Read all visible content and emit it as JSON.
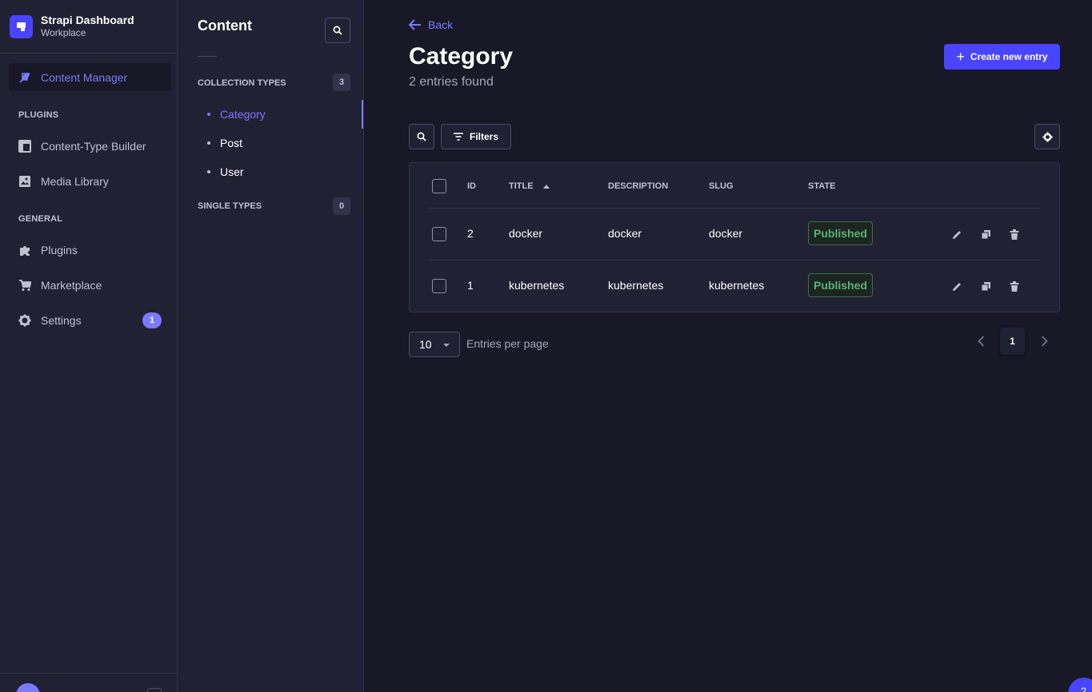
{
  "brand": {
    "title": "Strapi Dashboard",
    "subtitle": "Workplace",
    "accent": "#4945ff"
  },
  "sidebar": {
    "active_item": {
      "label": "Content Manager",
      "icon": "feather-icon"
    },
    "plugins_heading": "PLUGINS",
    "plugin_items": [
      {
        "label": "Content-Type Builder",
        "icon": "layout-icon"
      },
      {
        "label": "Media Library",
        "icon": "image-icon"
      }
    ],
    "general_heading": "GENERAL",
    "general_items": [
      {
        "label": "Plugins",
        "icon": "puzzle-icon"
      },
      {
        "label": "Marketplace",
        "icon": "cart-icon"
      },
      {
        "label": "Settings",
        "icon": "gear-icon",
        "badge": "1"
      }
    ]
  },
  "subnav": {
    "title": "Content",
    "collection_heading": "COLLECTION TYPES",
    "collection_count": "3",
    "collection_items": [
      "Category",
      "Post",
      "User"
    ],
    "active_item": "Category",
    "single_heading": "SINGLE TYPES",
    "single_count": "0"
  },
  "header": {
    "back_label": "Back",
    "title": "Category",
    "subtitle": "2 entries found",
    "create_label": "Create new entry"
  },
  "toolbar": {
    "filters_label": "Filters"
  },
  "table": {
    "columns": [
      "ID",
      "TITLE",
      "DESCRIPTION",
      "SLUG",
      "STATE"
    ],
    "sort_column": "TITLE",
    "rows": [
      {
        "id": "2",
        "title": "docker",
        "description": "docker",
        "slug": "docker",
        "state": "Published"
      },
      {
        "id": "1",
        "title": "kubernetes",
        "description": "kubernetes",
        "slug": "kubernetes",
        "state": "Published"
      }
    ]
  },
  "pagination": {
    "per_page_value": "10",
    "per_page_label": "Entries per page",
    "current_page": "1"
  },
  "colors": {
    "background": "#181826",
    "panel": "#212134",
    "accent": "#7b79ff",
    "published_text": "#5cb176"
  }
}
